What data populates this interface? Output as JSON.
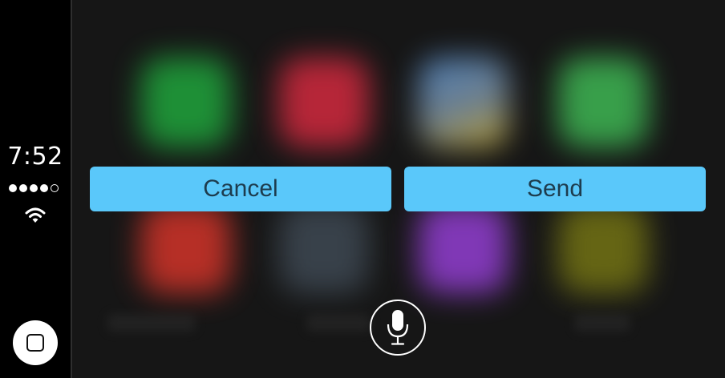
{
  "status_bar": {
    "time": "7:52",
    "signal_bars": 4,
    "signal_total": 5,
    "wifi_icon": "wifi-icon"
  },
  "home_button": {
    "icon": "home-square-icon"
  },
  "dialog": {
    "cancel_label": "Cancel",
    "send_label": "Send",
    "button_color": "#5ac8fa"
  },
  "siri": {
    "icon": "microphone-icon"
  },
  "background_apps": [
    {
      "color": "#1f9d3a"
    },
    {
      "color": "#c8283c"
    },
    {
      "color": "#5a7db4"
    },
    {
      "color": "#3cae50"
    },
    {
      "color": "#c83228"
    },
    {
      "color": "#3c4650"
    },
    {
      "color": "#8c3cc8"
    },
    {
      "color": "#6e6e14"
    }
  ]
}
